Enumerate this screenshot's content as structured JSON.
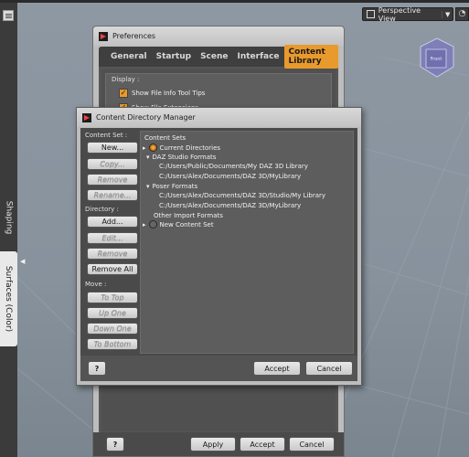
{
  "viewport": {
    "camera_label": "Perspective View",
    "cube_label": "Front"
  },
  "side_pane": {
    "tabs": [
      "Shaping",
      "Surfaces (Color)"
    ]
  },
  "preferences": {
    "title": "Preferences",
    "tabs": [
      "General",
      "Startup",
      "Scene",
      "Interface",
      "Content Library"
    ],
    "active_tab": "Content Library",
    "display_group": {
      "title": "Display :",
      "options": [
        {
          "label": "Show File Info Tool Tips",
          "checked": true
        },
        {
          "label": "Show File Extensions",
          "checked": true
        }
      ]
    },
    "buttons": {
      "help": "?",
      "apply": "Apply",
      "accept": "Accept",
      "cancel": "Cancel"
    }
  },
  "content_directory_manager": {
    "title": "Content Directory Manager",
    "content_set_label": "Content Set :",
    "new_button": "New...",
    "copy_button": "Copy...",
    "remove_button": "Remove",
    "rename_button": "Rename...",
    "directory_label": "Directory :",
    "add_button": "Add...",
    "edit_button": "Edit...",
    "dir_remove_button": "Remove",
    "remove_all_button": "Remove All",
    "move_label": "Move :",
    "to_top_button": "To Top",
    "up_one_button": "Up One",
    "down_one_button": "Down One",
    "to_bottom_button": "To Bottom",
    "tree": {
      "header": "Content Sets",
      "current_directories": "Current Directories",
      "daz_formats": "DAZ Studio Formats",
      "daz_paths": [
        "C:/Users/Public/Documents/My DAZ 3D Library",
        "C:/Users/Alex/Documents/DAZ 3D/MyLibrary"
      ],
      "poser_formats": "Poser Formats",
      "poser_paths": [
        "C:/Users/Alex/Documents/DAZ 3D/Studio/My Library",
        "C:/Users/Alex/Documents/DAZ 3D/MyLibrary"
      ],
      "other_formats": "Other Import Formats",
      "new_content_set": "New Content Set"
    },
    "buttons": {
      "help": "?",
      "accept": "Accept",
      "cancel": "Cancel"
    }
  },
  "colors": {
    "accent": "#e89a2c",
    "window_bg": "#bdbdbd",
    "panel_bg": "#4a4a4a"
  }
}
